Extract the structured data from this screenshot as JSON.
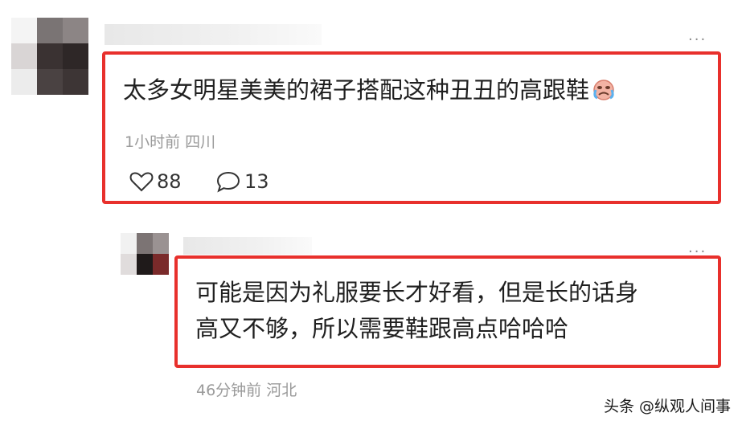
{
  "comment1": {
    "text": "太多女明星美美的裙子搭配这种丑丑的高跟鞋",
    "emoji_icon": "crying-face-emoji",
    "time": "1小时前",
    "location": "四川",
    "likes": "88",
    "replies": "13",
    "more_glyph": "..."
  },
  "reply1": {
    "text_line1": "可能是因为礼服要长才好看，但是长的话身",
    "text_line2": "高又不够，所以需要鞋跟高点哈哈哈",
    "time": "46分钟前",
    "location": "河北",
    "more_glyph": "..."
  },
  "watermark": "头条 @纵观人间事",
  "colors": {
    "highlight_border": "#e8302c",
    "meta_text": "#9a9a9a",
    "body_text": "#1f1f1f"
  }
}
